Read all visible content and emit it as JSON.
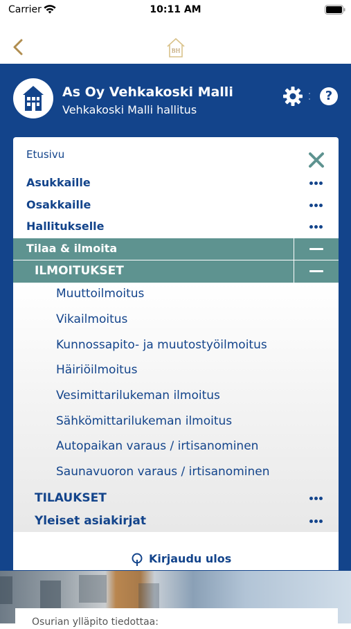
{
  "status": {
    "carrier": "Carrier",
    "time": "10:11 AM"
  },
  "nav": {
    "home_logo_text": "BH"
  },
  "header": {
    "title": "As Oy Vehkakoski Malli",
    "subtitle": "Vehkakoski Malli hallitus",
    "help_label": "?"
  },
  "menu": {
    "etusivu": "Etusivu",
    "items": [
      "Asukkaille",
      "Osakkaille",
      "Hallitukselle"
    ],
    "expanded_section": "Tilaa & ilmoita",
    "expanded_group": "ILMOITUKSET",
    "subitems": [
      "Muuttoilmoitus",
      "Vikailmoitus",
      "Kunnossapito- ja muutostyöilmoitus",
      "Häiriöilmoitus",
      "Vesimittarilukeman ilmoitus",
      "Sähkömittarilukeman ilmoitus",
      "Autopaikan varaus / irtisanominen",
      "Saunavuoron varaus / irtisanominen"
    ],
    "groups": [
      "TILAUKSET",
      "Yleiset asiakirjat"
    ],
    "logout": "Kirjaudu ulos"
  },
  "notice": {
    "text": "Osurian ylläpito tiedottaa:"
  },
  "colors": {
    "brand_blue": "#13448b",
    "teal": "#5e9390",
    "close_x": "#5e9390"
  }
}
